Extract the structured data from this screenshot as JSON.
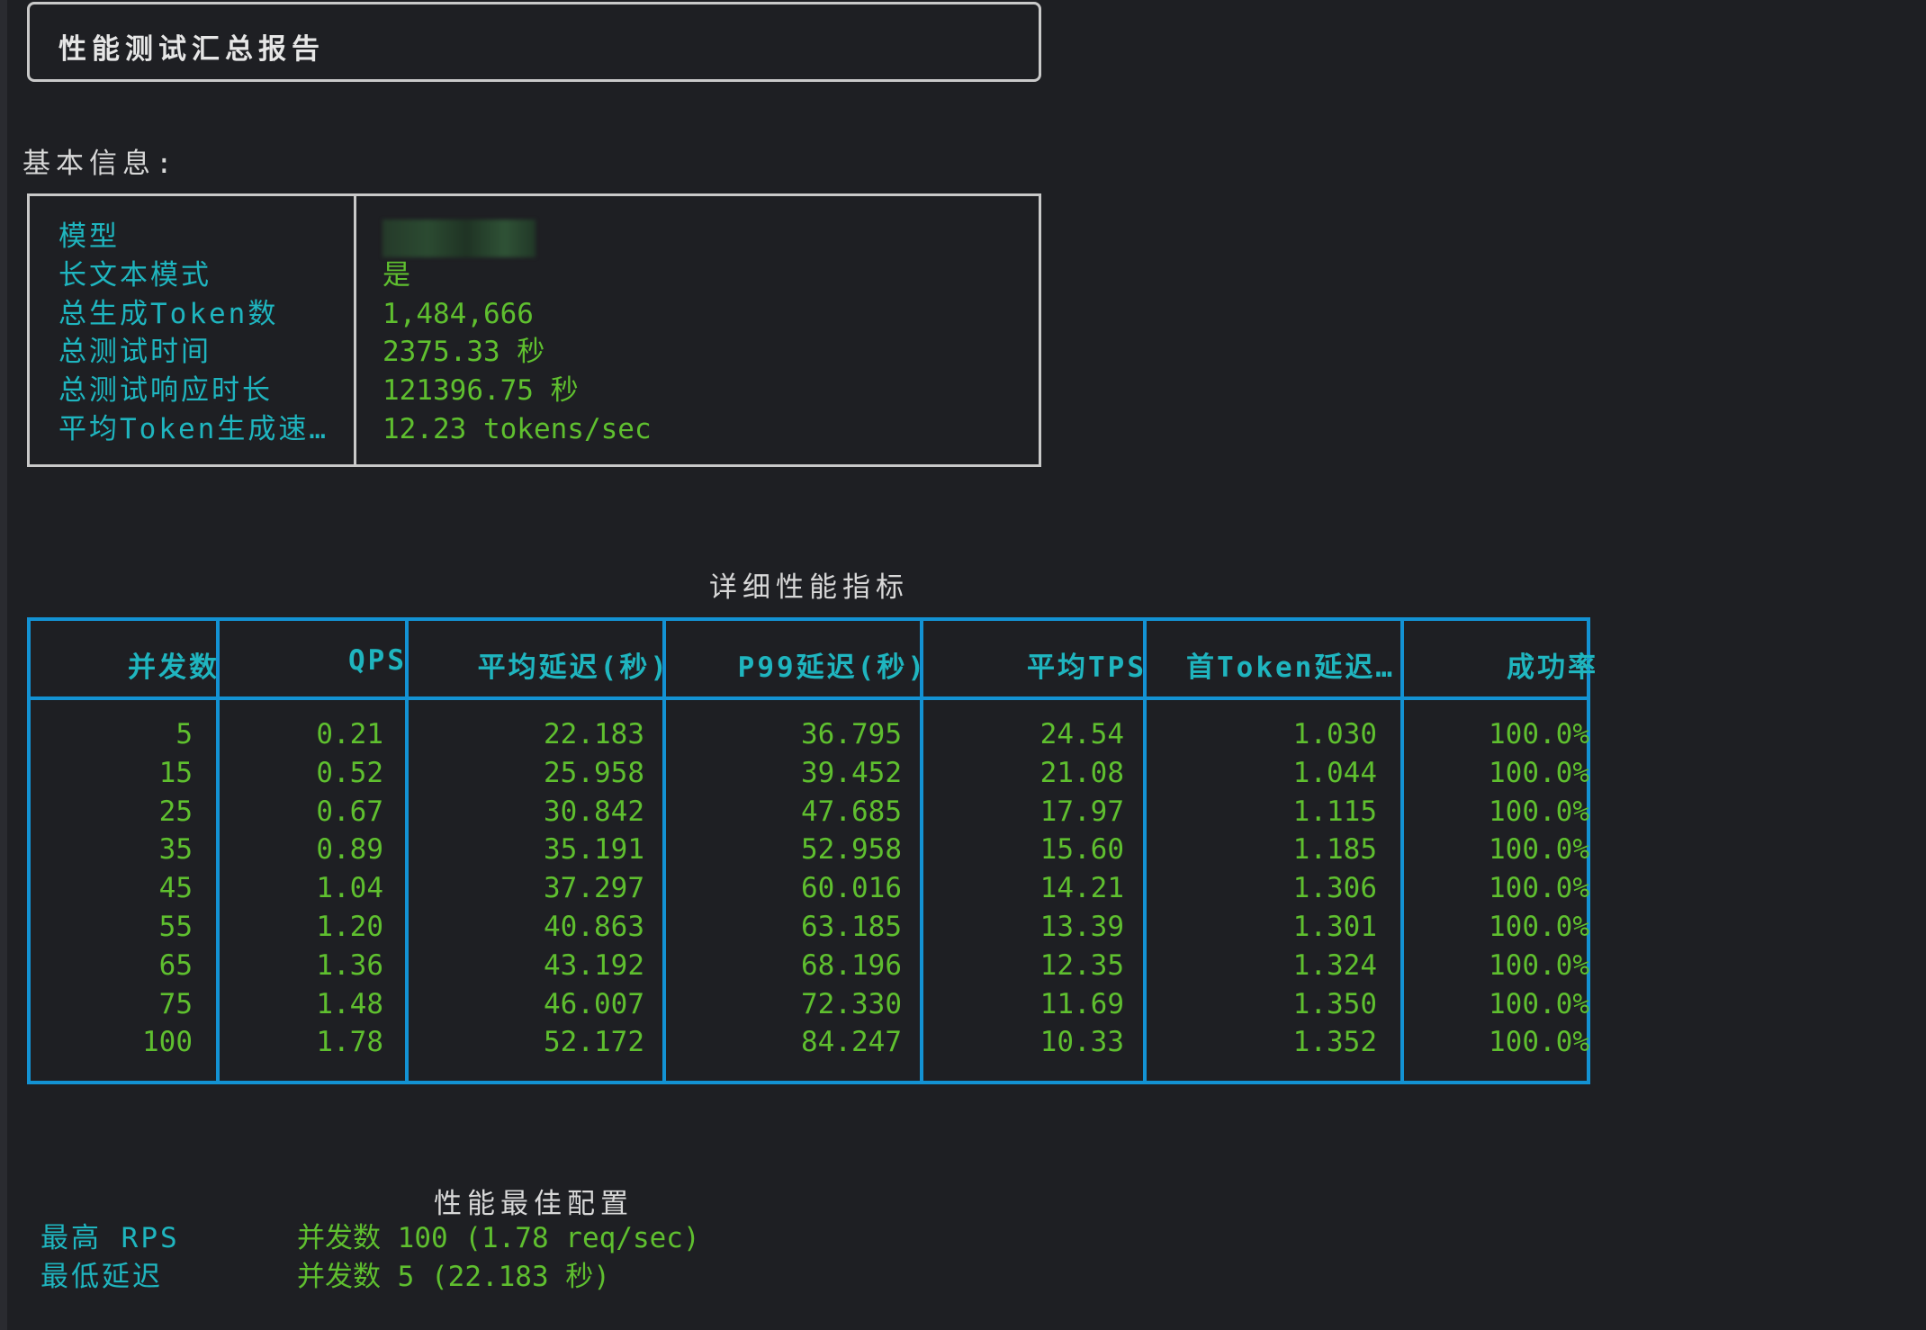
{
  "report": {
    "title": "性能测试汇总报告"
  },
  "basic_info": {
    "label": "基本信息:",
    "rows": [
      {
        "key": "模型",
        "value": ""
      },
      {
        "key": "长文本模式",
        "value": "是"
      },
      {
        "key": "总生成Token数",
        "value": "1,484,666"
      },
      {
        "key": "总测试时间",
        "value": "2375.33 秒"
      },
      {
        "key": "总测试响应时长",
        "value": "121396.75 秒"
      },
      {
        "key": "平均Token生成速…",
        "value": "12.23 tokens/sec"
      }
    ]
  },
  "metrics": {
    "title": "详细性能指标",
    "headers": [
      "并发数",
      "QPS",
      "平均延迟(秒)",
      "P99延迟(秒)",
      "平均TPS",
      "首Token延迟…",
      "成功率"
    ],
    "rows": [
      [
        "5",
        "0.21",
        "22.183",
        "36.795",
        "24.54",
        "1.030",
        "100.0%"
      ],
      [
        "15",
        "0.52",
        "25.958",
        "39.452",
        "21.08",
        "1.044",
        "100.0%"
      ],
      [
        "25",
        "0.67",
        "30.842",
        "47.685",
        "17.97",
        "1.115",
        "100.0%"
      ],
      [
        "35",
        "0.89",
        "35.191",
        "52.958",
        "15.60",
        "1.185",
        "100.0%"
      ],
      [
        "45",
        "1.04",
        "37.297",
        "60.016",
        "14.21",
        "1.306",
        "100.0%"
      ],
      [
        "55",
        "1.20",
        "40.863",
        "63.185",
        "13.39",
        "1.301",
        "100.0%"
      ],
      [
        "65",
        "1.36",
        "43.192",
        "68.196",
        "12.35",
        "1.324",
        "100.0%"
      ],
      [
        "75",
        "1.48",
        "46.007",
        "72.330",
        "11.69",
        "1.350",
        "100.0%"
      ],
      [
        "100",
        "1.78",
        "52.172",
        "84.247",
        "10.33",
        "1.352",
        "100.0%"
      ]
    ]
  },
  "best_config": {
    "title": "性能最佳配置",
    "rows": [
      {
        "key": "最高 RPS",
        "value": "并发数 100 (1.78 req/sec)"
      },
      {
        "key": "最低延迟",
        "value": "并发数 5 (22.183 秒)"
      }
    ]
  },
  "colors": {
    "background": "#1e1f23",
    "key_cyan": "#1fb5bf",
    "value_green": "#5fbf2f",
    "table_border_blue": "#1392d3",
    "box_border": "#c9c9c9"
  }
}
